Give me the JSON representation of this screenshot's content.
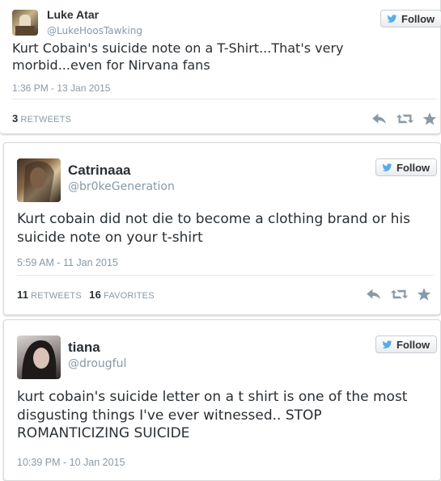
{
  "tweets": [
    {
      "name": "Luke Atar",
      "handle": "@LukeHoosTawking",
      "text": "Kurt Cobain's suicide note on a T-Shirt...That's very morbid...even for Nirvana fans",
      "time": "1:36 PM - 13 Jan 2015",
      "retweets_count": "3",
      "retweets_label": "RETWEETS",
      "follow_label": "Follow"
    },
    {
      "name": "Catrinaaa",
      "handle": "@br0keGeneration",
      "text": "Kurt cobain did not die to become a clothing brand or his suicide note on your t-shirt",
      "time": "5:59 AM - 11 Jan 2015",
      "retweets_count": "11",
      "retweets_label": "RETWEETS",
      "favorites_count": "16",
      "favorites_label": "FAVORITES",
      "follow_label": "Follow"
    },
    {
      "name": "tiana",
      "handle": "@drougful",
      "text": "kurt cobain's suicide letter on a t shirt is one of the most disgusting things I've ever witnessed.. STOP ROMANTICIZING SUICIDE",
      "time": "10:39 PM - 10 Jan 2015",
      "follow_label": "Follow"
    }
  ],
  "colors": {
    "twitter_blue": "#55acee",
    "text": "#292f33",
    "muted": "#8899a6",
    "icon": "#8899a6"
  },
  "icons": [
    "twitter-bird-icon",
    "reply-icon",
    "retweet-icon",
    "favorite-star-icon"
  ]
}
